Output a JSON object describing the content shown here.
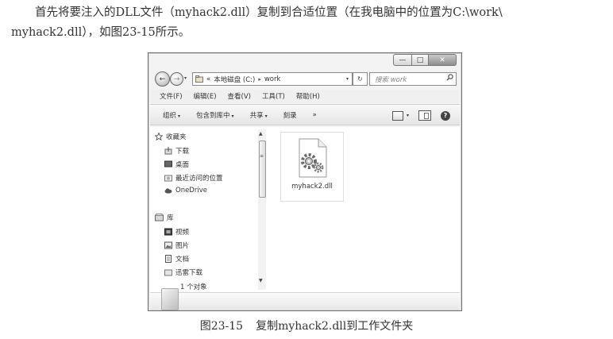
{
  "paragraph": {
    "line1": "首先将要注入的DLL文件（myhack2.dll）复制到合适位置（在我电脑中的位置为C:\\work\\",
    "line2": "myhack2.dll），如图23-15所示。"
  },
  "window": {
    "title_buttons": {
      "minimize": "—",
      "maximize": "□",
      "close": "✕"
    },
    "nav": {
      "back": "←",
      "forward": "→",
      "dropdown": "▾"
    },
    "address": {
      "prefix": "«",
      "drive": "本地磁盘 (C:)",
      "separator": "▸",
      "folder": "work",
      "dropdown": "▾",
      "refresh": "↻"
    },
    "search": {
      "placeholder": "搜索 work"
    },
    "menu": [
      "文件(F)",
      "编辑(E)",
      "查看(V)",
      "工具(T)",
      "帮助(H)"
    ],
    "toolbar": {
      "organize": "组织",
      "include_library": "包含到库中",
      "share": "共享",
      "burn": "刻录",
      "more": "»",
      "arrow": "▾",
      "help": "?"
    },
    "nav_pane": {
      "favorites": {
        "header": "收藏夹",
        "items": [
          "下载",
          "桌面",
          "最近访问的位置",
          "OneDrive"
        ]
      },
      "libraries": {
        "header": "库",
        "items": [
          "视频",
          "图片",
          "文档",
          "迅雷下载"
        ]
      }
    },
    "file": {
      "name": "myhack2.dll"
    },
    "status": {
      "text": "1 个对象"
    }
  },
  "caption": {
    "number": "图23-15",
    "text": "复制myhack2.dll到工作文件夹"
  }
}
